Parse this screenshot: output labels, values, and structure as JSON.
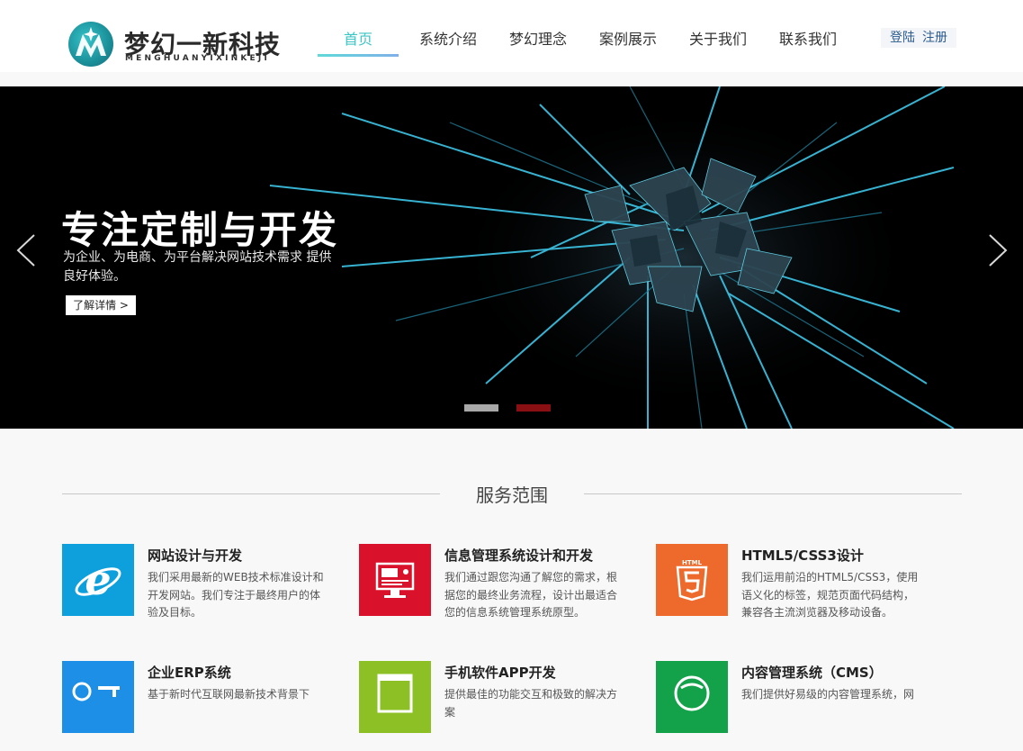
{
  "header": {
    "logo_title": "梦幻一新科技",
    "logo_subtitle": "MENGHUANYIXINKEJI",
    "nav": [
      {
        "label": "首页",
        "active": true
      },
      {
        "label": "系统介绍",
        "active": false
      },
      {
        "label": "梦幻理念",
        "active": false
      },
      {
        "label": "案例展示",
        "active": false
      },
      {
        "label": "关于我们",
        "active": false
      },
      {
        "label": "联系我们",
        "active": false
      }
    ],
    "login_label": "登陆",
    "register_label": "注册",
    "accent_color": "#3cc6c6"
  },
  "banner": {
    "title": "专注定制与开发",
    "description": "为企业、为电商、为平台解决网站技术需求 提供良好体验。",
    "button_label": "了解详情 >",
    "slides_total": 2,
    "active_slide": 2,
    "active_dot_color": "#8a0f12"
  },
  "services": {
    "title": "服务范围",
    "items": [
      {
        "name": "网站设计与开发",
        "desc": "我们采用最新的WEB技术标准设计和开发网站。我们专注于最终用户的体验及目标。",
        "icon": "ie-browser-icon",
        "color": "#0ea0dc"
      },
      {
        "name": "信息管理系统设计和开发",
        "desc": "我们通过跟您沟通了解您的需求，根据您的最终业务流程，设计出最适合您的信息系统管理系统原型。",
        "icon": "monitor-icon",
        "color": "#d9112a"
      },
      {
        "name": "HTML5/CSS3设计",
        "desc": "我们运用前沿的HTML5/CSS3，使用语义化的标签，规范页面代码结构，兼容各主流浏览器及移动设备。",
        "icon": "html5-icon",
        "color": "#ee6a2c"
      },
      {
        "name": "企业ERP系统",
        "desc": "基于新时代互联网最新技术背景下",
        "icon": "erp-icon",
        "color": "#1e8fe6"
      },
      {
        "name": "手机软件APP开发",
        "desc": "提供最佳的功能交互和极致的解决方案",
        "icon": "app-window-icon",
        "color": "#8cc024"
      },
      {
        "name": "内容管理系统（CMS）",
        "desc": "我们提供好易级的内容管理系统，网",
        "icon": "cms-icon",
        "color": "#13a14a"
      }
    ]
  }
}
